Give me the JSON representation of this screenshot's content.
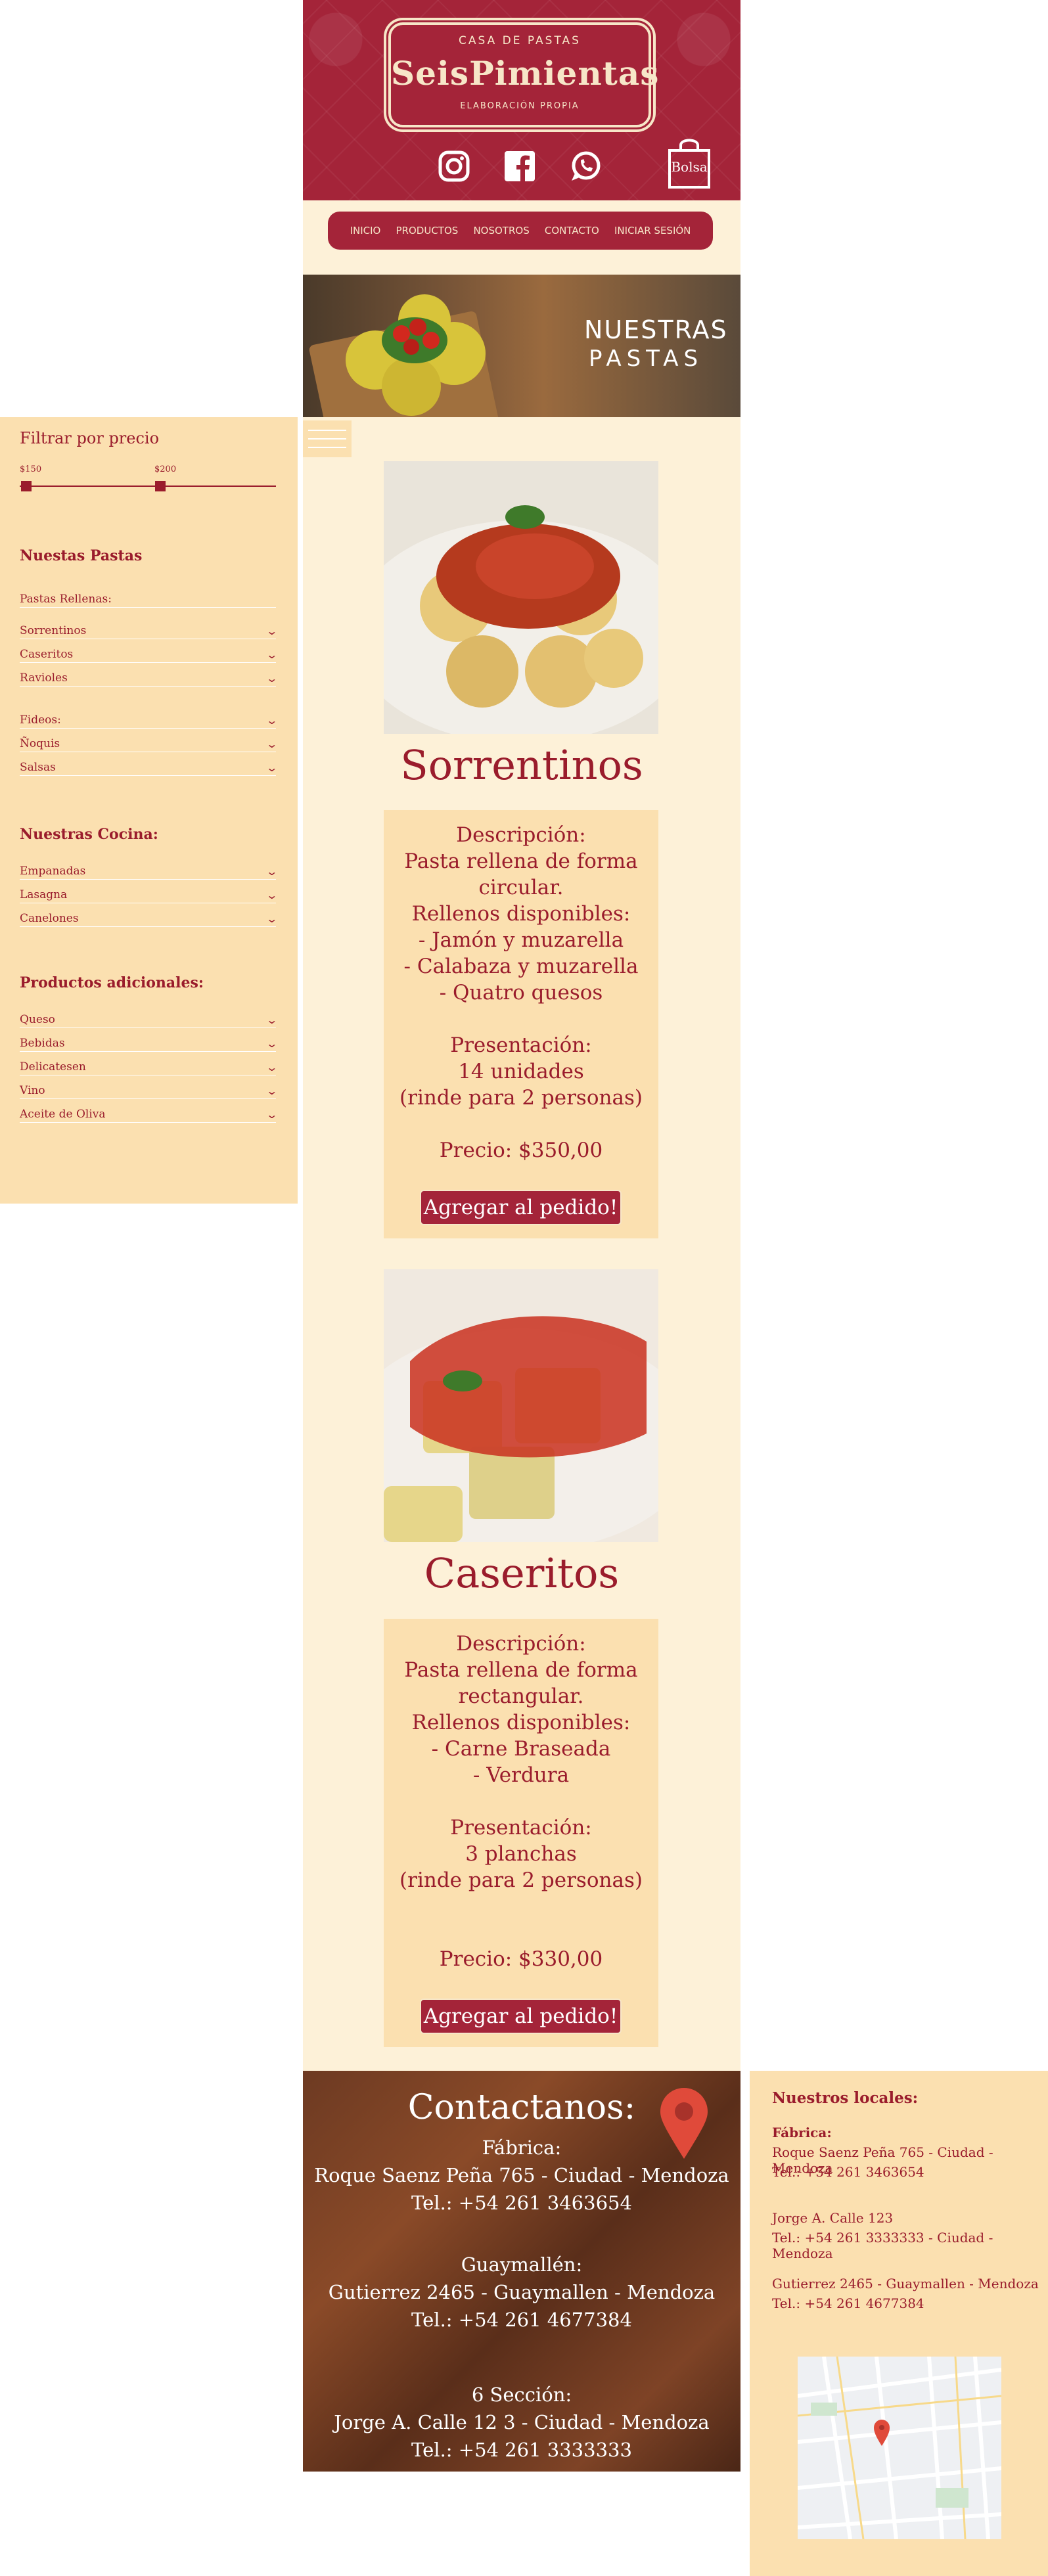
{
  "header": {
    "logo_top": "CASA DE PASTAS",
    "logo_main": "SeisPimientas",
    "logo_sub": "ELABORACIÓN PROPIA",
    "bag_label": "Bolsa"
  },
  "nav": {
    "items": [
      "Inicio",
      "Productos",
      "Nosotros",
      "Contacto",
      "Iniciar sesión"
    ]
  },
  "banner": {
    "line1": "NUESTRAS",
    "line2": "PASTAS"
  },
  "sidebar": {
    "filter_title": "Filtrar por precio",
    "price_min": "$150",
    "price_max": "$200",
    "section1_title": "Nuestas Pastas",
    "section1_sub": "Pastas Rellenas:",
    "rellenas": [
      "Sorrentinos",
      "Caseritos",
      "Ravioles"
    ],
    "otras": [
      "Fideos:",
      "Ñoquis",
      "Salsas"
    ],
    "section2_title": "Nuestras Cocina:",
    "cocina": [
      "Empanadas",
      "Lasagna",
      "Canelones"
    ],
    "section3_title": "Productos adicionales:",
    "adicionales": [
      "Queso",
      "Bebidas",
      "Delicatesen",
      "Vino",
      "Aceite de Oliva"
    ]
  },
  "products": [
    {
      "title": "Sorrentinos",
      "lines": [
        "Descripción:",
        "Pasta rellena de forma",
        "circular.",
        "Rellenos disponibles:",
        "- Jamón y muzarella",
        "- Calabaza y muzarella",
        "- Quatro quesos",
        "",
        "Presentación:",
        "14 unidades",
        "(rinde para 2 personas)",
        "",
        "Precio: $350,00"
      ],
      "button": "Agregar al pedido!"
    },
    {
      "title": "Caseritos",
      "lines": [
        "Descripción:",
        "Pasta rellena de forma",
        "rectangular.",
        "Rellenos disponibles:",
        "- Carne Braseada",
        "- Verdura",
        "",
        "Presentación:",
        "3 planchas",
        "(rinde para 2 personas)",
        "",
        "",
        "Precio: $330,00"
      ],
      "button": "Agregar al pedido!"
    }
  ],
  "contact": {
    "title": "Contactanos:",
    "lines": [
      "Fábrica:",
      "Roque Saenz Peña 765 - Ciudad - Mendoza",
      "Tel.: +54 261 3463654",
      "",
      "Guaymallén:",
      "Gutierrez 2465 - Guaymallen - Mendoza",
      "Tel.: +54 261 4677384",
      "",
      "",
      "6 Sección:",
      "Jorge A. Calle 12 3 - Ciudad - Mendoza",
      "Tel.: +54 261 3333333"
    ]
  },
  "locales": {
    "title": "Nuestros locales:",
    "lines": [
      "Fábrica:",
      "Roque Saenz Peña 765 - Ciudad - Mendoza",
      "Tel.: +54 261 3463654",
      "",
      "Jorge A. Calle 123",
      "Tel.: +54 261 3333333 - Ciudad - Mendoza",
      "",
      "Gutierrez 2465 - Guaymallen - Mendoza",
      "Tel.: +54 261 4677384"
    ]
  },
  "colors": {
    "brand": "#a42439",
    "cream": "#fdf1d8",
    "card": "#fbe0b0"
  }
}
